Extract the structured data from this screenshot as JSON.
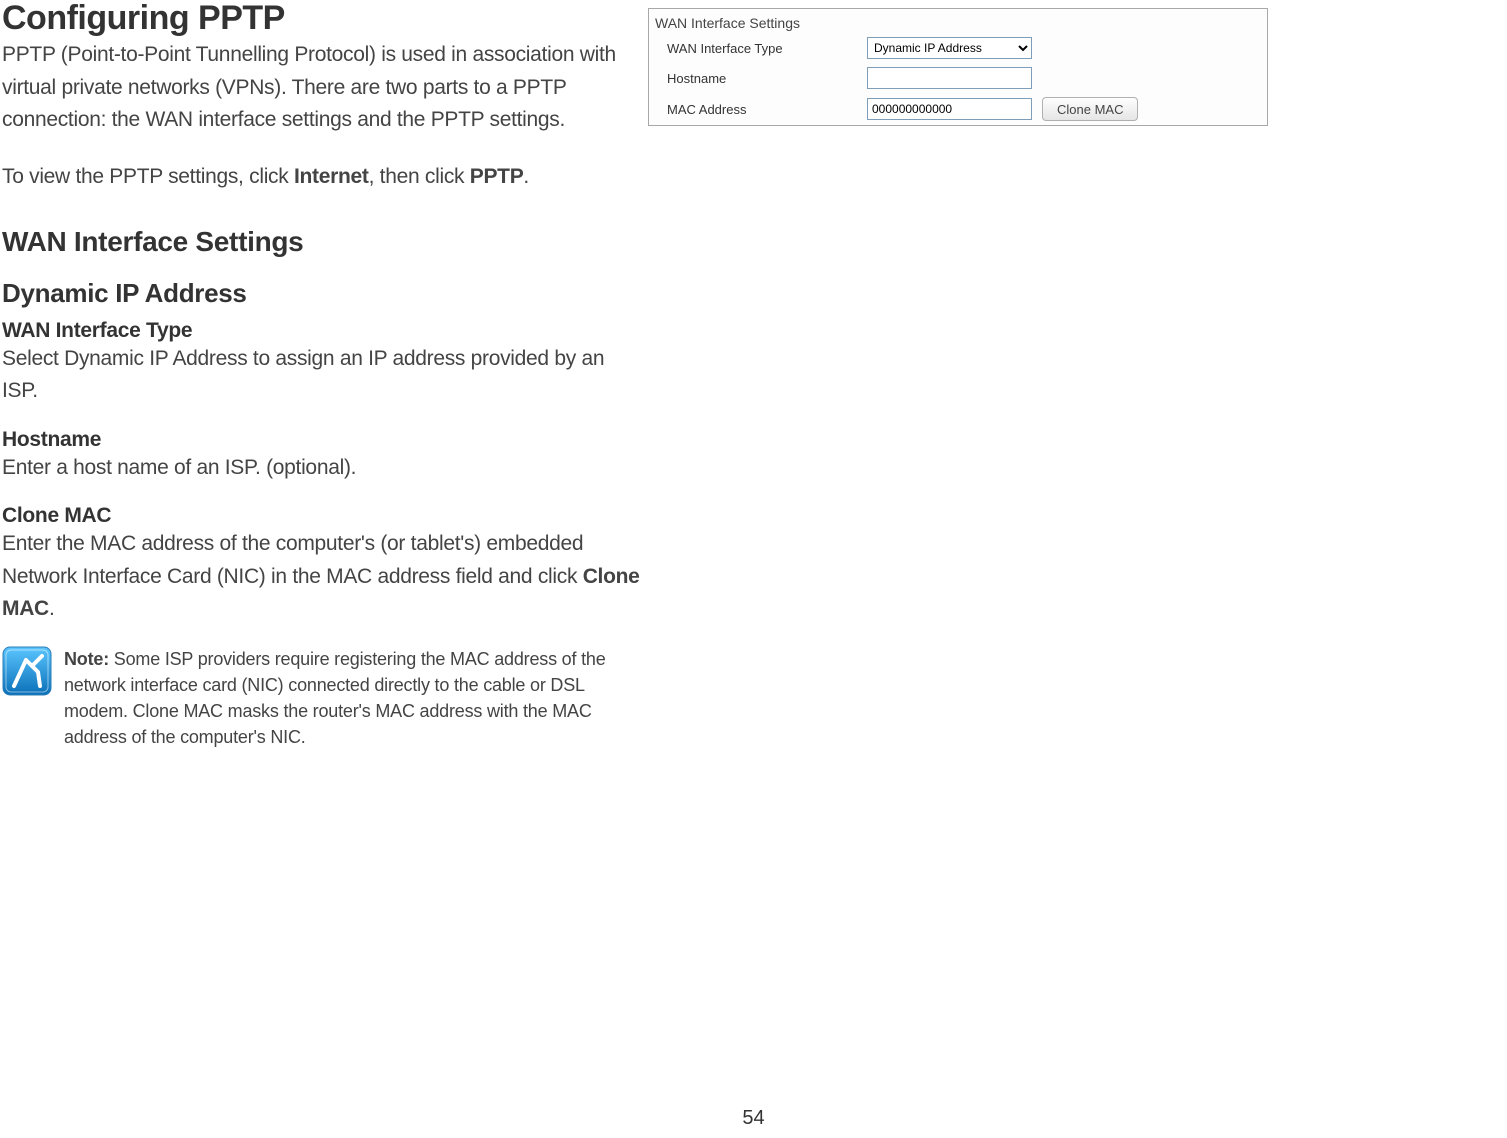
{
  "page_number": "54",
  "main": {
    "title": "Configuring PPTP",
    "intro_1": "PPTP (Point-to-Point Tunnelling Protocol) is used in association with virtual private networks (VPNs). There are two parts to a PPTP connection: the WAN interface settings and the PPTP settings.",
    "intro_2_pre": "To view the PPTP settings, click ",
    "intro_2_b1": "Internet",
    "intro_2_mid": ", then click ",
    "intro_2_b2": "PPTP",
    "intro_2_post": ".",
    "h2": "WAN Interface Settings",
    "h3": "Dynamic IP Address",
    "wan_type_label": "WAN Interface Type",
    "wan_type_desc": "Select Dynamic IP Address to assign an IP address provided by an ISP.",
    "hostname_label": "Hostname",
    "hostname_desc": "Enter a host name of an ISP. (optional).",
    "clonemac_label": "Clone MAC",
    "clonemac_desc_pre": "Enter the MAC address of the computer's (or tablet's) embedded Network Interface Card (NIC) in the MAC address field and click ",
    "clonemac_desc_b": "Clone MAC",
    "clonemac_desc_post": ".",
    "note_label": "Note:",
    "note_text": " Some ISP providers require registering the MAC address of the network interface card (NIC) connected directly to the cable or DSL modem. Clone MAC masks the router's MAC address with the MAC address of the computer's NIC."
  },
  "panel": {
    "title": "WAN Interface Settings",
    "rows": {
      "type_label": "WAN Interface Type",
      "type_value": "Dynamic IP Address",
      "hostname_label": "Hostname",
      "hostname_value": "",
      "mac_label": "MAC Address",
      "mac_value": "000000000000",
      "clone_button": "Clone MAC"
    }
  }
}
